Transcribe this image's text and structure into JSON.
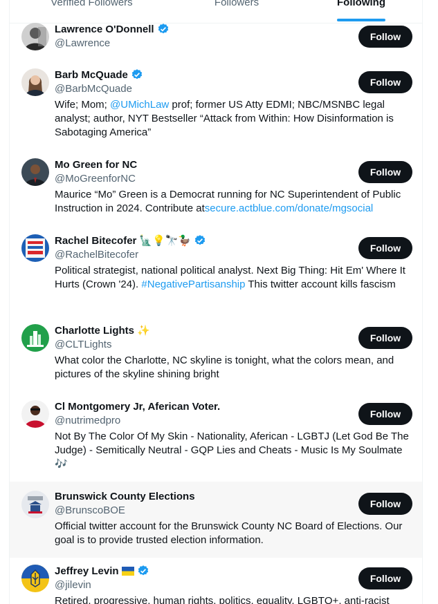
{
  "tabs": [
    {
      "label": "Verified Followers"
    },
    {
      "label": "Followers"
    },
    {
      "label": "Following"
    }
  ],
  "follow_label": "Follow",
  "colors": {
    "accent": "#1d9bf0",
    "follow_bg": "#0f1419"
  },
  "users": [
    {
      "name": "Lawrence O'Donnell",
      "handle": "@Lawrence",
      "verified": true,
      "emojis": "",
      "bio": []
    },
    {
      "name": "Barb McQuade",
      "handle": "@BarbMcQuade",
      "verified": true,
      "emojis": "",
      "bio": [
        {
          "text": "Wife; Mom; "
        },
        {
          "text": "@UMichLaw",
          "link": true
        },
        {
          "text": " prof; former US Atty EDMI; NBC/MSNBC legal analyst; author, NYT Bestseller “Attack from Within: How Disinformation is Sabotaging America”"
        }
      ]
    },
    {
      "name": "Mo Green for NC",
      "handle": "@MoGreenforNC",
      "verified": false,
      "emojis": "",
      "bio": [
        {
          "text": "Maurice “Mo” Green is a Democrat running for NC Superintendent of Public Instruction in 2024. Contribute at"
        },
        {
          "text": "secure.actblue.com/donate/mgsocial",
          "link": true
        }
      ]
    },
    {
      "name": "Rachel Bitecofer",
      "handle": "@RachelBitecofer",
      "verified": true,
      "emojis": "🗽💡🔭🦆",
      "bio": [
        {
          "text": "Political strategist, national political analyst. Next Big Thing: Hit Em' Where It Hurts (Crown '24). "
        },
        {
          "text": "#NegativePartisanship",
          "link": true
        },
        {
          "text": " This twitter account kills fascism"
        }
      ]
    },
    {
      "name": "Charlotte Lights",
      "handle": "@CLTLights",
      "verified": false,
      "emojis": "✨",
      "bio": [
        {
          "text": "What color the Charlotte, NC skyline is tonight, what the colors mean, and pictures of the skyline shining bright"
        }
      ]
    },
    {
      "name": "Cl Montgomery Jr, Aferican Voter.",
      "handle": "@nutrimedpro",
      "verified": false,
      "emojis": "",
      "bio": [
        {
          "text": "Not By The Color Of My Skin - Nationality, Aferican - LGBTJ (Let God Be The Judge) - Semitically Neutral - GQP Lies and Cheats - Music Is My Soulmate 🎶"
        }
      ]
    },
    {
      "name": "Brunswick County Elections",
      "handle": "@BrunscoBOE",
      "verified": false,
      "emojis": "",
      "bio": [
        {
          "text": "Official twitter account for the Brunswick County NC Board of Elections. Our goal is to provide trusted election information."
        }
      ]
    },
    {
      "name": "Jeffrey Levin",
      "handle": "@jilevin",
      "verified": true,
      "emojis": "🇺🇦",
      "bio": [
        {
          "text": "Retired, progressive, human rights, politics, equality, LGBTQ+, anti-racist"
        }
      ]
    }
  ]
}
